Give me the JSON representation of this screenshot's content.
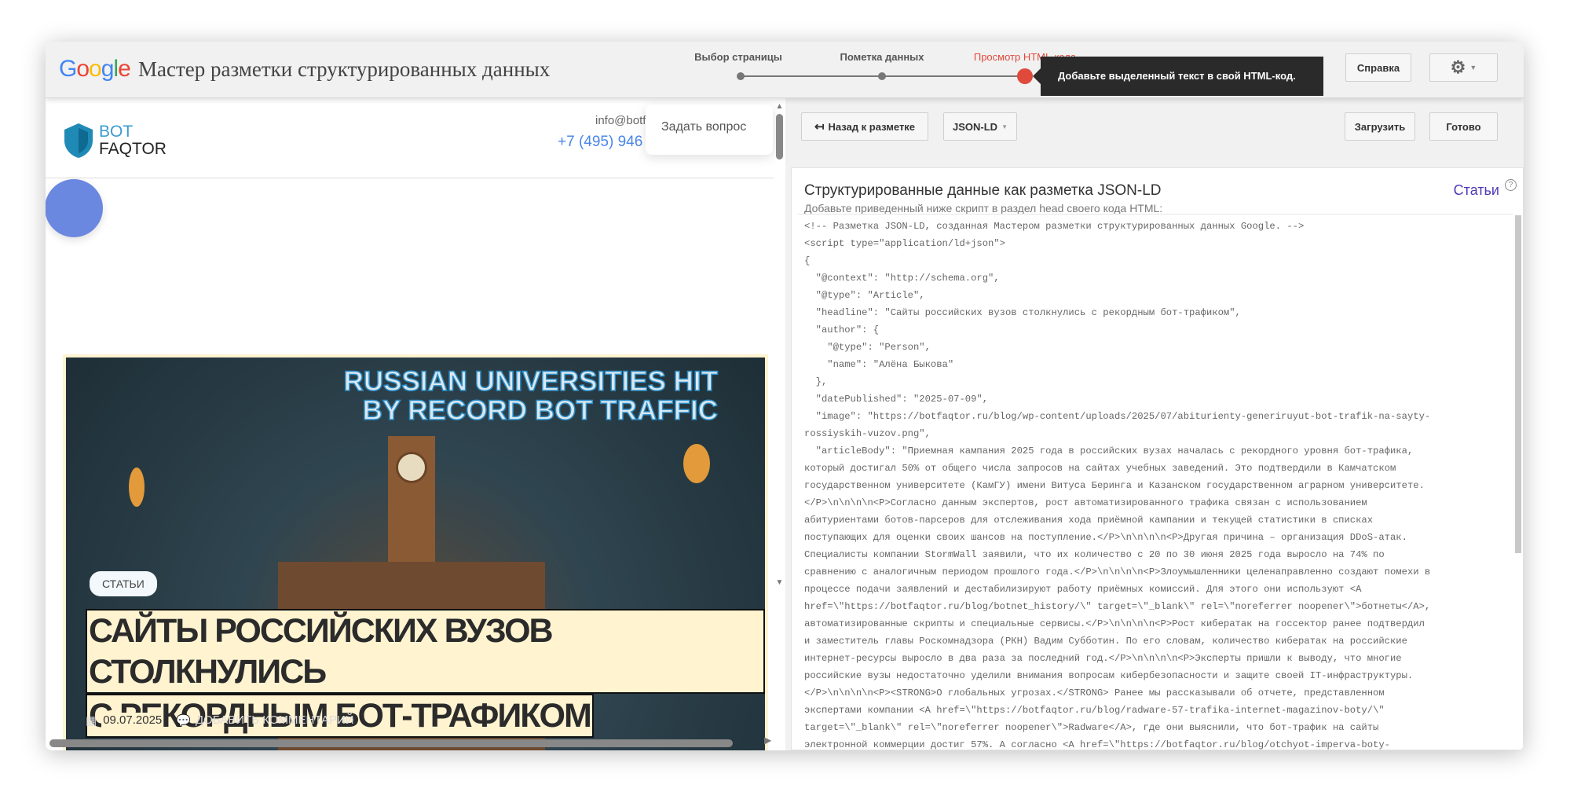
{
  "header": {
    "title": "Мастер разметки структурированных данных",
    "steps": [
      {
        "label": "Выбор страницы"
      },
      {
        "label": "Пометка данных"
      },
      {
        "label": "Просмотр HTML-кода"
      }
    ],
    "tooltip": "Добавьте выделенный текст в свой HTML-код.",
    "help_label": "Справка"
  },
  "site": {
    "logo_top": "BOT",
    "logo_bottom": "FAQTOR",
    "email": "info@botf",
    "phone": "+7 (495) 946",
    "ask_label": "Задать вопрос",
    "hero_title_en_1": "RUSSIAN UNIVERSITIES HIT",
    "hero_title_en_2": "BY RECORD BOT TRAFFIC",
    "category": "СТАТЬИ",
    "headline_1": "САЙТЫ РОССИЙСКИХ ВУЗОВ СТОЛКНУЛИСЬ",
    "headline_2": "С РЕКОРДНЫМ БОТ-ТРАФИКОМ",
    "date": "09.07.2025",
    "comment_label": "ДОБАВИТЬ КОММЕНТАРИЙ"
  },
  "toolbar": {
    "back_label": "Назад к разметке",
    "format_label": "JSON-LD",
    "download_label": "Загрузить",
    "done_label": "Готово"
  },
  "panel": {
    "title": "Структурированные данные как разметка JSON-LD",
    "subtitle": "Добавьте приведенный ниже скрипт в раздел head своего кода HTML:",
    "type_link": "Статьи"
  },
  "code_lines": [
    "<!-- Разметка JSON-LD, созданная Мастером разметки структурированных данных Google. -->",
    "<script type=\"application/ld+json\">",
    "{",
    "  \"@context\": \"http://schema.org\",",
    "  \"@type\": \"Article\",",
    "  \"headline\": \"Сайты российских вузов столкнулись с рекордным бот-трафиком\",",
    "  \"author\": {",
    "    \"@type\": \"Person\",",
    "    \"name\": \"Алёна Быкова\"",
    "  },",
    "  \"datePublished\": \"2025-07-09\",",
    "  \"image\": \"https://botfaqtor.ru/blog/wp-content/uploads/2025/07/abiturienty-generiruyut-bot-trafik-na-sayty-",
    "rossiyskih-vuzov.png\",",
    "  \"articleBody\": \"Приемная кампания 2025 года в российских вузах началась с рекордного уровня бот-трафика,",
    "который достигал 50% от общего числа запросов на сайтах учебных заведений. Это подтвердили в Камчатском",
    "государственном университете (КамГУ) имени Витуса Беринга и Казанском государственном аграрном университете.",
    "</P>\\n\\n\\n\\n<P>Согласно данным экспертов, рост автоматизированного трафика связан с использованием",
    "абитуриентами ботов-парсеров для отслеживания хода приёмной кампании и текущей статистики в списках",
    "поступающих для оценки своих шансов на поступление.</P>\\n\\n\\n\\n<P>Другая причина – организация DDoS-атак.",
    "Специалисты компании StormWall заявили, что их количество с 20 по 30 июня 2025 года выросло на 74% по",
    "сравнению с аналогичным периодом прошлого года.</P>\\n\\n\\n\\n<P>Злоумышленники целенаправленно создают помехи в",
    "процессе подачи заявлений и дестабилизируют работу приёмных комиссий. Для этого они используют <A",
    "href=\\\"https://botfaqtor.ru/blog/botnet_history/\\\" target=\\\"_blank\\\" rel=\\\"noreferrer noopener\\\">ботнеты</A>,",
    "автоматизированные скрипты и специальные сервисы.</P>\\n\\n\\n\\n<P>Рост кибератак на госсектор ранее подтвердил",
    "и заместитель главы Роскомнадзора (РКН) Вадим Субботин. По его словам, количество кибератак на российские",
    "интернет-ресурсы выросло в два раза за последний год.</P>\\n\\n\\n\\n<P>Эксперты пришли к выводу, что многие",
    "российские вузы недостаточно уделили внимания вопросам кибербезопасности и защите своей IT-инфраструктуры.",
    "</P>\\n\\n\\n\\n<P><STRONG>О глобальных угрозах.</STRONG> Ранее мы рассказывали об отчете, представленном",
    "экспертами компании <A href=\\\"https://botfaqtor.ru/blog/radware-57-trafika-internet-magazinov-boty/\\\"",
    "target=\\\"_blank\\\" rel=\\\"noreferrer noopener\\\">Radware</A>, где они выяснили, что бот-трафик на сайты",
    "электронной коммерции достиг 57%. А согласно <A href=\\\"https://botfaqtor.ru/blog/otchyot-imperva-boty-"
  ],
  "colors": {
    "accent_red": "#e04a3c",
    "link_purple": "#4c3ab8",
    "phone_blue": "#4a86e8",
    "highlight": "#fff3d0"
  }
}
